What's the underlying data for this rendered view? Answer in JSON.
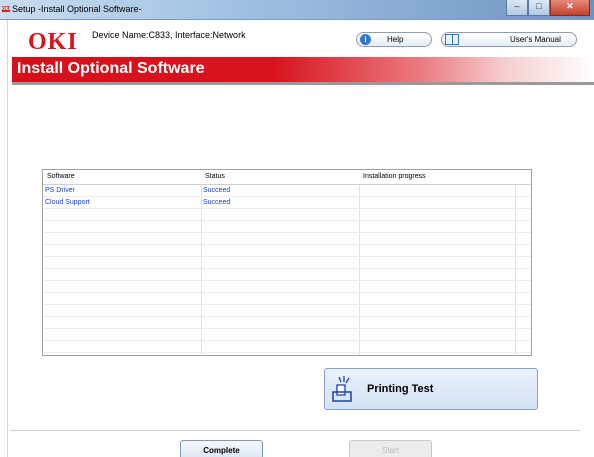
{
  "window": {
    "title": "Setup -Install Optional Software-",
    "app_icon_text": "OKI",
    "minimize_glyph": "–",
    "maximize_glyph": "□",
    "close_glyph": "✕"
  },
  "header": {
    "logo": "OKI",
    "device_info": "Device Name:C833, Interface:Network",
    "help_label": "Help",
    "manual_label": "User's Manual"
  },
  "banner": {
    "title": "Install Optional Software"
  },
  "table": {
    "columns": [
      "Software",
      "Status",
      "Installation progress"
    ],
    "rows": [
      {
        "software": "PS Driver",
        "status": "Succeed",
        "progress": ""
      },
      {
        "software": "Cloud Support",
        "status": "Succeed",
        "progress": ""
      }
    ]
  },
  "actions": {
    "printing_test_label": "Printing Test",
    "complete_label": "Complete",
    "start_label": "Start"
  },
  "colors": {
    "brand_red": "#d8141e",
    "link_blue": "#1a3fd0"
  }
}
